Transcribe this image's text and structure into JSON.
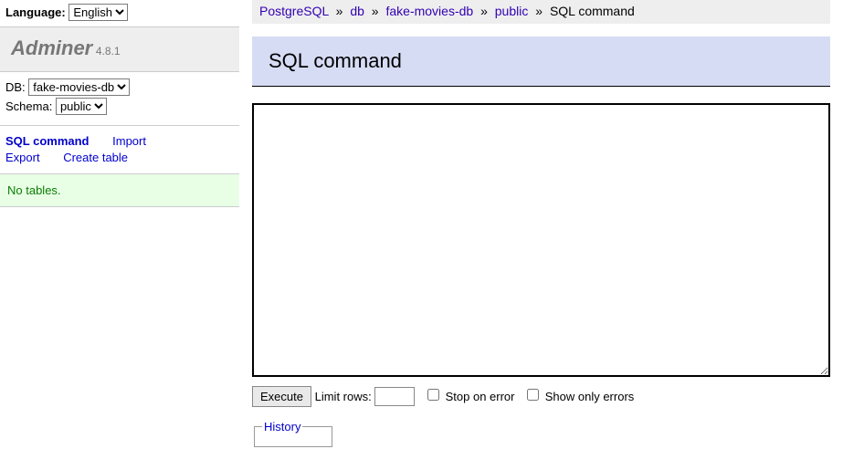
{
  "lang": {
    "label": "Language:",
    "options": [
      "English"
    ],
    "value": "English"
  },
  "brand": {
    "name": "Adminer",
    "version": "4.8.1"
  },
  "dbsel": {
    "db_label": "DB:",
    "db_options": [
      "fake-movies-db"
    ],
    "db_value": "fake-movies-db",
    "schema_label": "Schema:",
    "schema_options": [
      "public"
    ],
    "schema_value": "public"
  },
  "links": {
    "sql": "SQL command",
    "import": "Import",
    "export": "Export",
    "create": "Create table"
  },
  "message": "No tables.",
  "breadcrumb": {
    "server": "PostgreSQL",
    "db": "db",
    "dbname": "fake-movies-db",
    "schema": "public",
    "page": "SQL command",
    "sep": "»"
  },
  "heading": "SQL command",
  "form": {
    "query": "",
    "execute": "Execute",
    "limit_label": "Limit rows:",
    "limit_value": "",
    "stop_label": "Stop on error",
    "only_label": "Show only errors",
    "history": "History"
  }
}
